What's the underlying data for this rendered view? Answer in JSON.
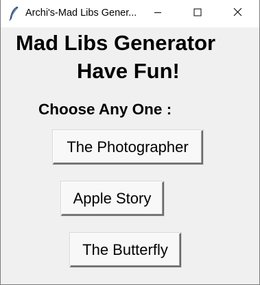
{
  "window": {
    "title": "Archi's-Mad Libs Gener...",
    "icon": "feather-icon",
    "controls": {
      "minimize_icon": "minimize-icon",
      "maximize_icon": "maximize-icon",
      "close_icon": "close-icon"
    }
  },
  "main": {
    "heading_line1": "Mad Libs Generator",
    "heading_line2": "Have Fun!",
    "prompt": "Choose Any One :",
    "buttons": [
      {
        "label": "The Photographer"
      },
      {
        "label": "Apple Story"
      },
      {
        "label": "The Butterfly"
      }
    ]
  },
  "colors": {
    "titlebar_bg": "#ffffff",
    "window_bg": "#f0f0f0",
    "button_bg": "#f8f8f8",
    "text": "#000000"
  }
}
